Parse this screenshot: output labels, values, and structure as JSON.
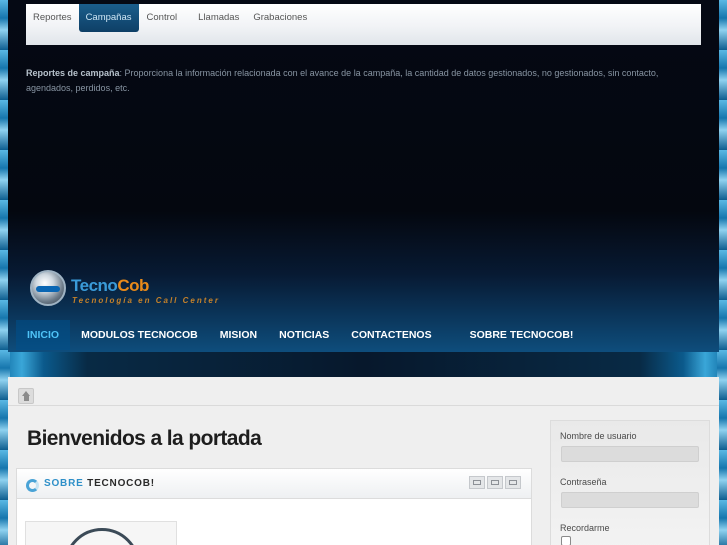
{
  "submenu": {
    "tabs": [
      {
        "label": "Reportes"
      },
      {
        "label": "Campañas"
      },
      {
        "label": "Control"
      },
      {
        "label": "Llamadas"
      },
      {
        "label": "Grabaciones"
      }
    ],
    "active_index": 1
  },
  "description": {
    "heading": "Reportes de campaña",
    "text": ": Proporciona la información relacionada con el avance de la campaña, la cantidad de datos gestionados, no gestionados, sin contacto, agendados, perdidos, etc."
  },
  "logo": {
    "name_part1": "Tecno",
    "name_part2": "Cob",
    "tagline": "Tecnología en Call Center"
  },
  "mainnav": {
    "items": [
      {
        "label": "INICIO"
      },
      {
        "label": "MODULOS TECNOCOB"
      },
      {
        "label": "MISION"
      },
      {
        "label": "NOTICIAS"
      },
      {
        "label": "CONTACTENOS"
      },
      {
        "label": "SOBRE TECNOCOB!"
      }
    ],
    "active_index": 0
  },
  "page": {
    "title": "Bienvenidos a la portada"
  },
  "article": {
    "title_part1": "SOBRE",
    "title_part2": "TECNOCOB!",
    "tools": [
      "email-icon",
      "print-icon",
      "pdf-icon"
    ]
  },
  "login": {
    "username_label": "Nombre de usuario",
    "password_label": "Contraseña",
    "remember_label": "Recordarme"
  },
  "colors": {
    "accent": "#2e8fc8",
    "nav_active": "#4fc3f7",
    "logo_orange": "#e88a1a"
  }
}
